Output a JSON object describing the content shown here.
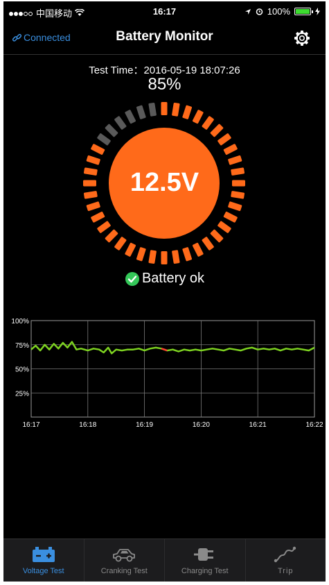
{
  "status_bar": {
    "carrier": "中国移动",
    "time": "16:17",
    "battery": "100%"
  },
  "nav": {
    "connection": "Connected",
    "title": "Battery Monitor"
  },
  "test": {
    "label": "Test Time：",
    "datetime": "2016-05-19 18:07:26",
    "percent": "85%"
  },
  "gauge": {
    "voltage": "12.5V",
    "level": 0.85,
    "color_active": "#ff6a1a",
    "color_inactive": "#5a5a5a"
  },
  "status": {
    "text": "Battery ok",
    "color": "#34c759"
  },
  "chart_data": {
    "type": "line",
    "x_ticks": [
      "16:17",
      "16:18",
      "16:19",
      "16:20",
      "16:21",
      "16:22"
    ],
    "y_ticks": [
      "100%",
      "75%",
      "50%",
      "25%"
    ],
    "ylim": [
      0,
      100
    ],
    "xlim_minutes": [
      0,
      5
    ],
    "grid": true,
    "line_color": "#7ed321",
    "highlight_color": "#ff3b30",
    "series": [
      {
        "values": [
          [
            0.0,
            70
          ],
          [
            0.08,
            74
          ],
          [
            0.16,
            69
          ],
          [
            0.24,
            75
          ],
          [
            0.32,
            70
          ],
          [
            0.4,
            76
          ],
          [
            0.48,
            71
          ],
          [
            0.56,
            77
          ],
          [
            0.64,
            72
          ],
          [
            0.72,
            78
          ],
          [
            0.8,
            70
          ],
          [
            0.88,
            71
          ],
          [
            1.0,
            69
          ],
          [
            1.1,
            71
          ],
          [
            1.2,
            70
          ],
          [
            1.28,
            67
          ],
          [
            1.36,
            72
          ],
          [
            1.42,
            66
          ],
          [
            1.5,
            70
          ],
          [
            1.6,
            69
          ],
          [
            1.7,
            70
          ],
          [
            1.8,
            70
          ],
          [
            1.9,
            71
          ],
          [
            2.0,
            69
          ],
          [
            2.1,
            71
          ],
          [
            2.2,
            72
          ],
          [
            2.3,
            71
          ],
          [
            2.4,
            69
          ],
          [
            2.5,
            70
          ],
          [
            2.6,
            68
          ],
          [
            2.7,
            70
          ],
          [
            2.8,
            69
          ],
          [
            2.9,
            70
          ],
          [
            3.0,
            69
          ],
          [
            3.1,
            70
          ],
          [
            3.2,
            71
          ],
          [
            3.3,
            70
          ],
          [
            3.4,
            69
          ],
          [
            3.5,
            71
          ],
          [
            3.6,
            70
          ],
          [
            3.7,
            69
          ],
          [
            3.8,
            71
          ],
          [
            3.9,
            72
          ],
          [
            4.0,
            70
          ],
          [
            4.1,
            71
          ],
          [
            4.2,
            70
          ],
          [
            4.3,
            71
          ],
          [
            4.4,
            69
          ],
          [
            4.5,
            71
          ],
          [
            4.6,
            70
          ],
          [
            4.7,
            71
          ],
          [
            4.8,
            70
          ],
          [
            4.9,
            69
          ],
          [
            5.0,
            72
          ]
        ],
        "highlight_x": [
          2.22,
          2.4
        ]
      }
    ]
  },
  "tabs": [
    {
      "label": "Voltage Test",
      "icon": "battery-icon",
      "active": true
    },
    {
      "label": "Cranking Test",
      "icon": "car-icon",
      "active": false
    },
    {
      "label": "Charging Test",
      "icon": "plug-icon",
      "active": false
    },
    {
      "label": "Trip",
      "icon": "route-icon",
      "active": false
    }
  ]
}
